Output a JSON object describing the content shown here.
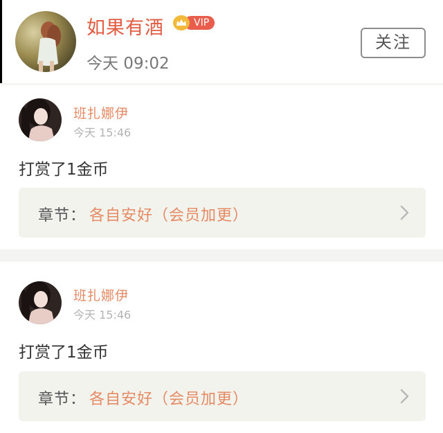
{
  "header": {
    "user_name": "如果有酒",
    "vip_label": "VIP",
    "time": "今天 09:02",
    "follow_label": "关注",
    "colors": {
      "name": "#e35b40",
      "vip": "#e85d4b",
      "crown": "#f2b93a"
    }
  },
  "feed": [
    {
      "user_name": "班扎娜伊",
      "time": "今天 15:46",
      "text": "打赏了1金币",
      "chapter_label": "章节：",
      "chapter_title": "各自安好（会员加更）"
    },
    {
      "user_name": "班扎娜伊",
      "time": "今天 15:46",
      "text": "打赏了1金币",
      "chapter_label": "章节：",
      "chapter_title": "各自安好（会员加更）"
    }
  ],
  "icons": {
    "vip": "crown-icon",
    "chapter_arrow": "chevron-right-icon"
  }
}
